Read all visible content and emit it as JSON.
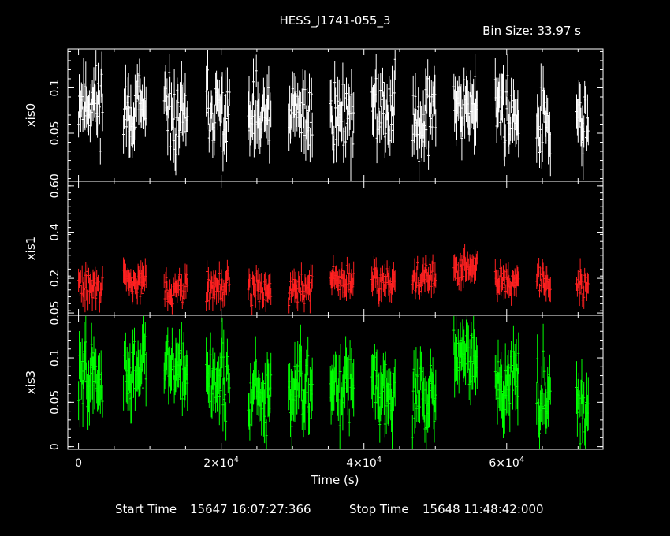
{
  "title": "HESS_J1741-055_3",
  "bin_size_text": "Bin Size: 33.97 s",
  "footer": {
    "start_label": "Start Time",
    "start_value": "15647 16:07:27:366",
    "stop_label": "Stop Time",
    "stop_value": "15648 11:48:42:000"
  },
  "chart_data": {
    "type": "scatter",
    "xlabel": "Time (s)",
    "x_range": [
      -1500,
      73500
    ],
    "x_ticks": [
      {
        "value": 0,
        "label": "0"
      },
      {
        "value": 20000,
        "label": "2×10",
        "sup": "4"
      },
      {
        "value": 40000,
        "label": "4×10",
        "sup": "4"
      },
      {
        "value": 60000,
        "label": "6×10",
        "sup": "4"
      }
    ],
    "colors": {
      "background": "#000000",
      "axes": "#ffffff",
      "xis0": "#ffffff",
      "xis1": "#ff2020",
      "xis3": "#00ff00"
    },
    "segments": [
      {
        "start": 0,
        "end": 3400
      },
      {
        "start": 6300,
        "end": 9500
      },
      {
        "start": 12000,
        "end": 15300
      },
      {
        "start": 17900,
        "end": 21200
      },
      {
        "start": 23800,
        "end": 27000
      },
      {
        "start": 29500,
        "end": 32800
      },
      {
        "start": 35300,
        "end": 38600
      },
      {
        "start": 41100,
        "end": 44400
      },
      {
        "start": 46800,
        "end": 50100
      },
      {
        "start": 52600,
        "end": 55900
      },
      {
        "start": 58400,
        "end": 61700
      },
      {
        "start": 64200,
        "end": 66200
      },
      {
        "start": 69800,
        "end": 71500
      }
    ],
    "panels": [
      {
        "name": "xis0",
        "ylabel": "xis0",
        "ylim": [
          -0.003,
          0.143
        ],
        "y_ticks": [
          {
            "value": 0.05,
            "label": "0.05"
          },
          {
            "value": 0.1,
            "label": "0.1"
          }
        ],
        "segment_levels": [
          0.085,
          0.075,
          0.065,
          0.07,
          0.065,
          0.07,
          0.07,
          0.075,
          0.07,
          0.085,
          0.075,
          0.06,
          0.055
        ],
        "scatter": 0.025,
        "err": 0.022,
        "seed": 11
      },
      {
        "name": "xis1",
        "ylabel": "xis1",
        "ylim": [
          0.04,
          0.62
        ],
        "y_ticks": [
          {
            "value": 0.05,
            "label": "0.05"
          },
          {
            "value": 0.2,
            "label": "0.2"
          },
          {
            "value": 0.4,
            "label": "0.4"
          },
          {
            "value": 0.6,
            "label": "0.60"
          }
        ],
        "segment_levels": [
          0.17,
          0.18,
          0.15,
          0.16,
          0.16,
          0.16,
          0.19,
          0.2,
          0.2,
          0.24,
          0.19,
          0.18,
          0.18
        ],
        "scatter": 0.04,
        "err": 0.045,
        "seed": 29
      },
      {
        "name": "xis3",
        "ylabel": "xis3",
        "ylim": [
          -0.003,
          0.148
        ],
        "y_ticks": [
          {
            "value": 0,
            "label": "0"
          },
          {
            "value": 0.05,
            "label": "0.05"
          },
          {
            "value": 0.1,
            "label": "0.1"
          }
        ],
        "segment_levels": [
          0.08,
          0.085,
          0.09,
          0.075,
          0.055,
          0.07,
          0.07,
          0.065,
          0.055,
          0.1,
          0.07,
          0.065,
          0.05
        ],
        "scatter": 0.025,
        "err": 0.025,
        "seed": 47
      }
    ]
  }
}
